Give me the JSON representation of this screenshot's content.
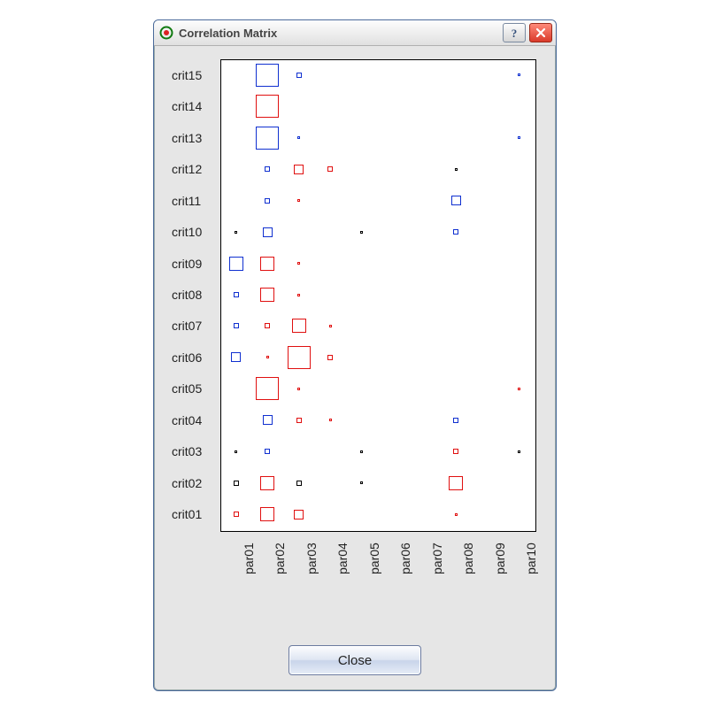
{
  "window": {
    "title": "Correlation Matrix",
    "help_tooltip": "Help",
    "close_tooltip": "Close"
  },
  "buttons": {
    "close": "Close"
  },
  "chart_data": {
    "type": "heatmap",
    "xlabel": "",
    "ylabel": "",
    "x": [
      "par01",
      "par02",
      "par03",
      "par04",
      "par05",
      "par06",
      "par07",
      "par08",
      "par09",
      "par10"
    ],
    "y_top_to_bottom": [
      "crit15",
      "crit14",
      "crit13",
      "crit12",
      "crit11",
      "crit10",
      "crit09",
      "crit08",
      "crit07",
      "crit06",
      "crit05",
      "crit04",
      "crit03",
      "crit02",
      "crit01"
    ],
    "encoding": "squares sized by |value|, outlined; color: red=negative, blue=positive, black≈0",
    "size_scale_comment": "size is qualitative: 1=tiny dot, 2=very small, 3=small, 4=medium, 5=large",
    "cells": [
      {
        "y": "crit15",
        "x": "par02",
        "sign": "pos",
        "size": 5
      },
      {
        "y": "crit15",
        "x": "par03",
        "sign": "pos",
        "size": 2
      },
      {
        "y": "crit15",
        "x": "par10",
        "sign": "pos",
        "size": 1
      },
      {
        "y": "crit14",
        "x": "par02",
        "sign": "neg",
        "size": 5
      },
      {
        "y": "crit13",
        "x": "par02",
        "sign": "pos",
        "size": 5
      },
      {
        "y": "crit13",
        "x": "par03",
        "sign": "pos",
        "size": 1
      },
      {
        "y": "crit13",
        "x": "par10",
        "sign": "pos",
        "size": 1
      },
      {
        "y": "crit12",
        "x": "par02",
        "sign": "pos",
        "size": 2
      },
      {
        "y": "crit12",
        "x": "par03",
        "sign": "neg",
        "size": 3
      },
      {
        "y": "crit12",
        "x": "par04",
        "sign": "neg",
        "size": 2
      },
      {
        "y": "crit12",
        "x": "par08",
        "sign": "zero",
        "size": 1
      },
      {
        "y": "crit11",
        "x": "par02",
        "sign": "pos",
        "size": 2
      },
      {
        "y": "crit11",
        "x": "par03",
        "sign": "neg",
        "size": 1
      },
      {
        "y": "crit11",
        "x": "par08",
        "sign": "pos",
        "size": 3
      },
      {
        "y": "crit10",
        "x": "par01",
        "sign": "zero",
        "size": 1
      },
      {
        "y": "crit10",
        "x": "par02",
        "sign": "pos",
        "size": 3
      },
      {
        "y": "crit10",
        "x": "par05",
        "sign": "zero",
        "size": 1
      },
      {
        "y": "crit10",
        "x": "par08",
        "sign": "pos",
        "size": 2
      },
      {
        "y": "crit09",
        "x": "par01",
        "sign": "pos",
        "size": 4
      },
      {
        "y": "crit09",
        "x": "par02",
        "sign": "neg",
        "size": 4
      },
      {
        "y": "crit09",
        "x": "par03",
        "sign": "neg",
        "size": 1
      },
      {
        "y": "crit08",
        "x": "par01",
        "sign": "pos",
        "size": 2
      },
      {
        "y": "crit08",
        "x": "par02",
        "sign": "neg",
        "size": 4
      },
      {
        "y": "crit08",
        "x": "par03",
        "sign": "neg",
        "size": 1
      },
      {
        "y": "crit07",
        "x": "par01",
        "sign": "pos",
        "size": 2
      },
      {
        "y": "crit07",
        "x": "par02",
        "sign": "neg",
        "size": 2
      },
      {
        "y": "crit07",
        "x": "par03",
        "sign": "neg",
        "size": 4
      },
      {
        "y": "crit07",
        "x": "par04",
        "sign": "neg",
        "size": 1
      },
      {
        "y": "crit06",
        "x": "par01",
        "sign": "pos",
        "size": 3
      },
      {
        "y": "crit06",
        "x": "par02",
        "sign": "neg",
        "size": 1
      },
      {
        "y": "crit06",
        "x": "par03",
        "sign": "neg",
        "size": 5
      },
      {
        "y": "crit06",
        "x": "par04",
        "sign": "neg",
        "size": 2
      },
      {
        "y": "crit05",
        "x": "par02",
        "sign": "neg",
        "size": 5
      },
      {
        "y": "crit05",
        "x": "par03",
        "sign": "neg",
        "size": 1
      },
      {
        "y": "crit05",
        "x": "par10",
        "sign": "neg",
        "size": 1
      },
      {
        "y": "crit04",
        "x": "par02",
        "sign": "pos",
        "size": 3
      },
      {
        "y": "crit04",
        "x": "par03",
        "sign": "neg",
        "size": 2
      },
      {
        "y": "crit04",
        "x": "par04",
        "sign": "neg",
        "size": 1
      },
      {
        "y": "crit04",
        "x": "par08",
        "sign": "pos",
        "size": 2
      },
      {
        "y": "crit03",
        "x": "par01",
        "sign": "zero",
        "size": 1
      },
      {
        "y": "crit03",
        "x": "par02",
        "sign": "pos",
        "size": 2
      },
      {
        "y": "crit03",
        "x": "par05",
        "sign": "zero",
        "size": 1
      },
      {
        "y": "crit03",
        "x": "par08",
        "sign": "neg",
        "size": 2
      },
      {
        "y": "crit03",
        "x": "par10",
        "sign": "zero",
        "size": 1
      },
      {
        "y": "crit02",
        "x": "par01",
        "sign": "zero",
        "size": 2
      },
      {
        "y": "crit02",
        "x": "par02",
        "sign": "neg",
        "size": 4
      },
      {
        "y": "crit02",
        "x": "par03",
        "sign": "zero",
        "size": 2
      },
      {
        "y": "crit02",
        "x": "par05",
        "sign": "zero",
        "size": 1
      },
      {
        "y": "crit02",
        "x": "par08",
        "sign": "neg",
        "size": 4
      },
      {
        "y": "crit01",
        "x": "par01",
        "sign": "neg",
        "size": 2
      },
      {
        "y": "crit01",
        "x": "par02",
        "sign": "neg",
        "size": 4
      },
      {
        "y": "crit01",
        "x": "par03",
        "sign": "neg",
        "size": 3
      },
      {
        "y": "crit01",
        "x": "par08",
        "sign": "neg",
        "size": 1
      }
    ]
  }
}
